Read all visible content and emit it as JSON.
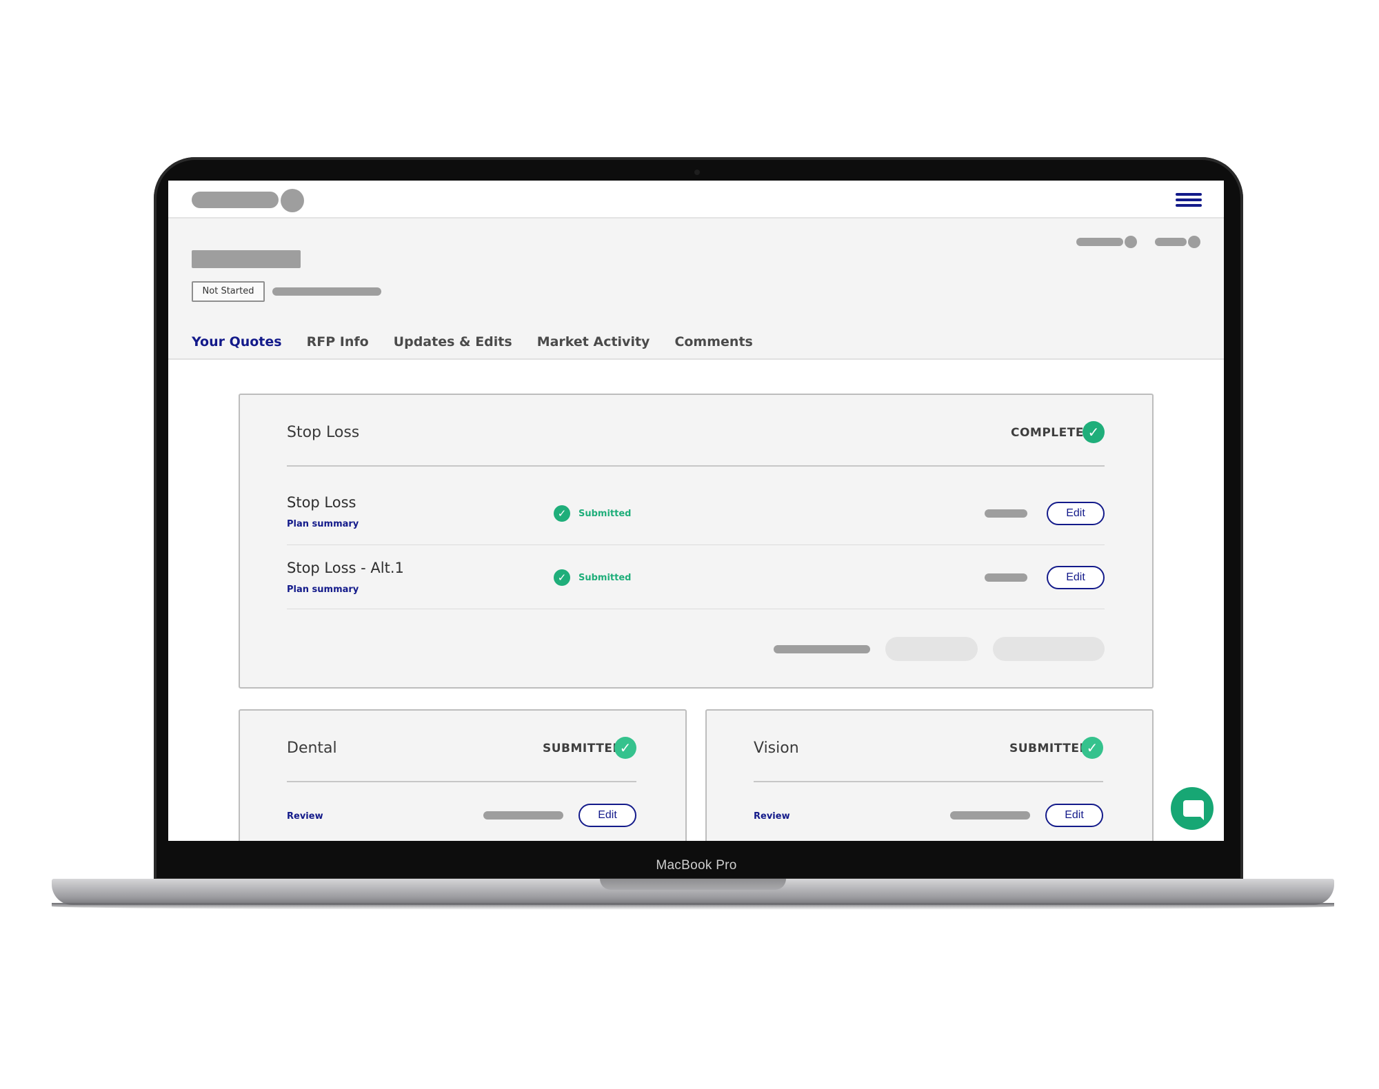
{
  "device": {
    "label": "MacBook Pro"
  },
  "header": {
    "menu_icon": "hamburger-menu-icon",
    "status_chip": "Not Started"
  },
  "tabs": [
    {
      "label": "Your Quotes",
      "active": true
    },
    {
      "label": "RFP Info",
      "active": false
    },
    {
      "label": "Updates & Edits",
      "active": false
    },
    {
      "label": "Market Activity",
      "active": false
    },
    {
      "label": "Comments",
      "active": false
    }
  ],
  "stop_loss": {
    "title": "Stop Loss",
    "status": "COMPLETE",
    "rows": [
      {
        "title": "Stop Loss",
        "link": "Plan summary",
        "state": "Submitted",
        "button": "Edit"
      },
      {
        "title": "Stop Loss - Alt.1",
        "link": "Plan summary",
        "state": "Submitted",
        "button": "Edit"
      }
    ]
  },
  "dental": {
    "title": "Dental",
    "status": "SUBMITTED",
    "link": "Review",
    "button": "Edit"
  },
  "vision": {
    "title": "Vision",
    "status": "SUBMITTED",
    "link": "Review",
    "button": "Edit"
  },
  "colors": {
    "brand_navy": "#131a8a",
    "success_green": "#1fae7a",
    "chat_green": "#17a774"
  },
  "icons": {
    "check": "✓",
    "chat": "chat-bubble-icon"
  }
}
